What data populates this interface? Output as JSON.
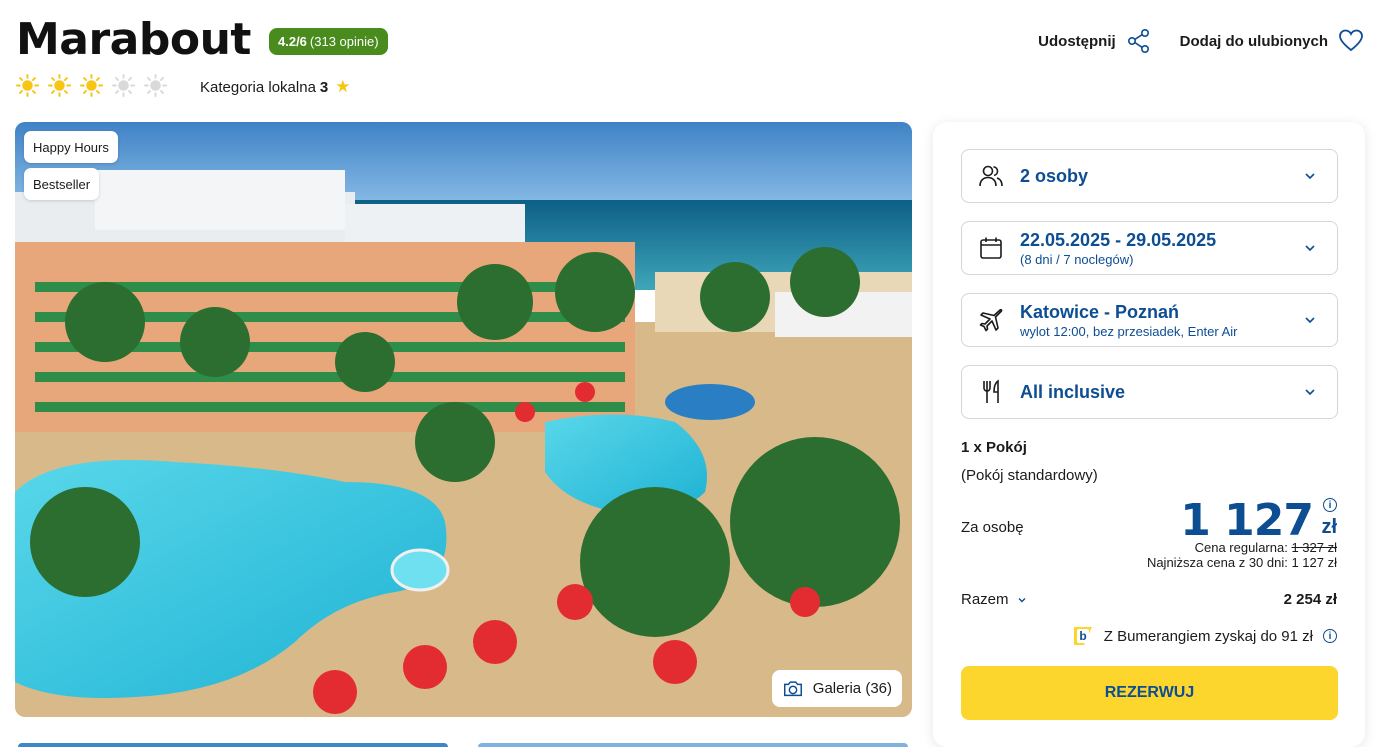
{
  "hotel": {
    "name": "Marabout",
    "rating_score": "4.2/6",
    "rating_reviews": "(313 opinie)",
    "suns_filled": 3,
    "suns_total": 5,
    "category_label": "Kategoria lokalna",
    "category_value": "3"
  },
  "actions": {
    "share_label": "Udostępnij",
    "favorite_label": "Dodaj do ulubionych"
  },
  "gallery": {
    "tags": [
      "Happy Hours",
      "Bestseller"
    ],
    "gallery_button_label": "Galeria (36)"
  },
  "booking": {
    "persons": "2 osoby",
    "dates": "22.05.2025 - 29.05.2025",
    "dates_sub": "(8 dni / 7 noclegów)",
    "flight": "Katowice - Poznań",
    "flight_sub": "wylot 12:00, bez przesiadek, Enter Air",
    "board": "All inclusive",
    "room_count": "1 x Pokój",
    "room_type": "(Pokój standardowy)",
    "per_person_label": "Za osobę",
    "price": "1 127",
    "currency": "zł",
    "regular_label": "Cena regularna:",
    "regular_price": "1 327 zł",
    "lowest_label": "Najniższa cena z 30 dni: 1 127 zł",
    "total_label": "Razem",
    "total_value": "2 254 zł",
    "bumerang_text": "Z Bumerangiem zyskaj do 91 zł",
    "reserve_label": "REZERWUJ"
  },
  "colors": {
    "brand_blue": "#0d4d92",
    "rating_green": "#4a8b1e",
    "cta_yellow": "#fcd52d",
    "sun_yellow": "#f6c516",
    "sun_grey": "#d9d9d9"
  }
}
